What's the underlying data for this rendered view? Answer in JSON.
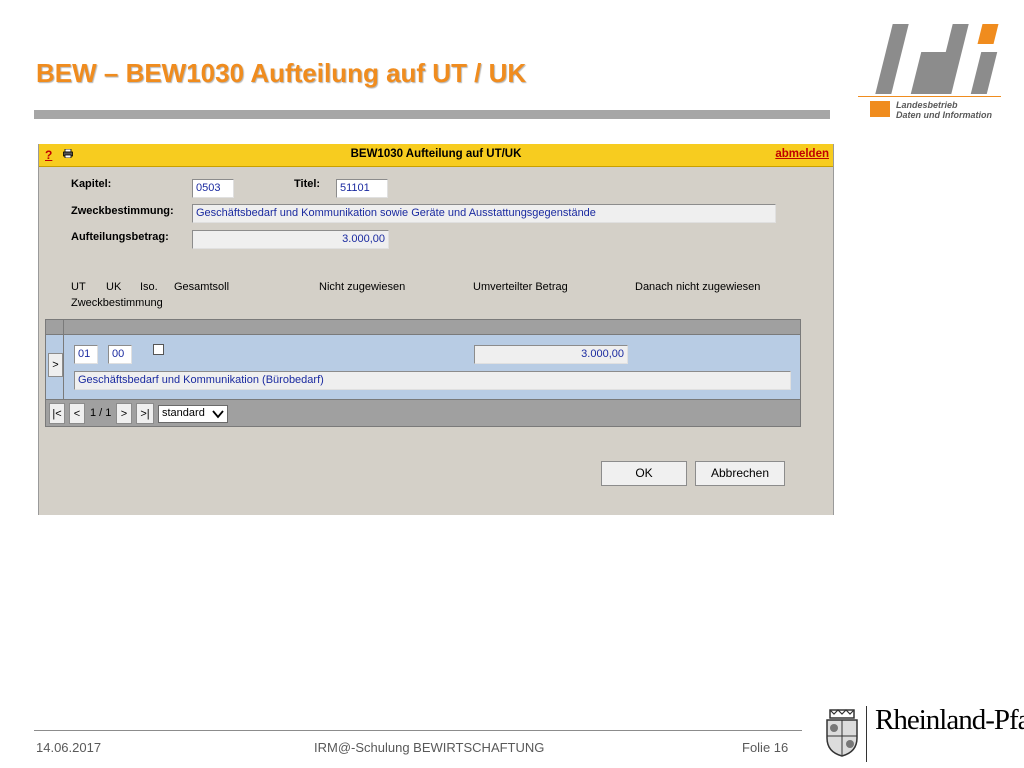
{
  "slide": {
    "title": "BEW – BEW1030 Aufteilung auf UT / UK",
    "footer_date": "14.06.2017",
    "footer_center": "IRM@-Schulung BEWIRTSCHAFTUNG",
    "footer_page": "Folie 16"
  },
  "logo": {
    "line1": "Landesbetrieb",
    "line2": "Daten und Information",
    "brand": "Rheinland-Pfalz"
  },
  "window": {
    "help": "?",
    "title": "BEW1030 Aufteilung auf UT/UK",
    "logout": "abmelden"
  },
  "form": {
    "kapitel_label": "Kapitel:",
    "kapitel_value": "0503",
    "titel_label": "Titel:",
    "titel_value": "51101",
    "zweck_label": "Zweckbestimmung:",
    "zweck_value": "Geschäftsbedarf und Kommunikation sowie Geräte und Ausstattungsgegenstände",
    "betrag_label": "Aufteilungsbetrag:",
    "betrag_value": "3.000,00"
  },
  "columns": {
    "ut": "UT",
    "uk": "UK",
    "iso": "Iso.",
    "gesamtsoll": "Gesamtsoll",
    "nicht_zugewiesen": "Nicht zugewiesen",
    "umverteilt": "Umverteilter Betrag",
    "danach": "Danach nicht zugewiesen",
    "zweck": "Zweckbestimmung"
  },
  "row": {
    "expand": ">",
    "ut": "01",
    "uk": "00",
    "iso_checked": false,
    "umverteilt": "3.000,00",
    "zweck": "Geschäftsbedarf und Kommunikation (Bürobedarf)"
  },
  "nav": {
    "first": "|<",
    "prev": "<",
    "page": "1 / 1",
    "next": ">",
    "last": ">|",
    "view": "standard"
  },
  "buttons": {
    "ok": "OK",
    "cancel": "Abbrechen"
  },
  "colors": {
    "accent_orange": "#f08c1e",
    "titlebar_yellow": "#f7cc1f",
    "link_red": "#c00000",
    "field_text_blue": "#1a2aa0",
    "row_blue": "#b8cce4"
  }
}
